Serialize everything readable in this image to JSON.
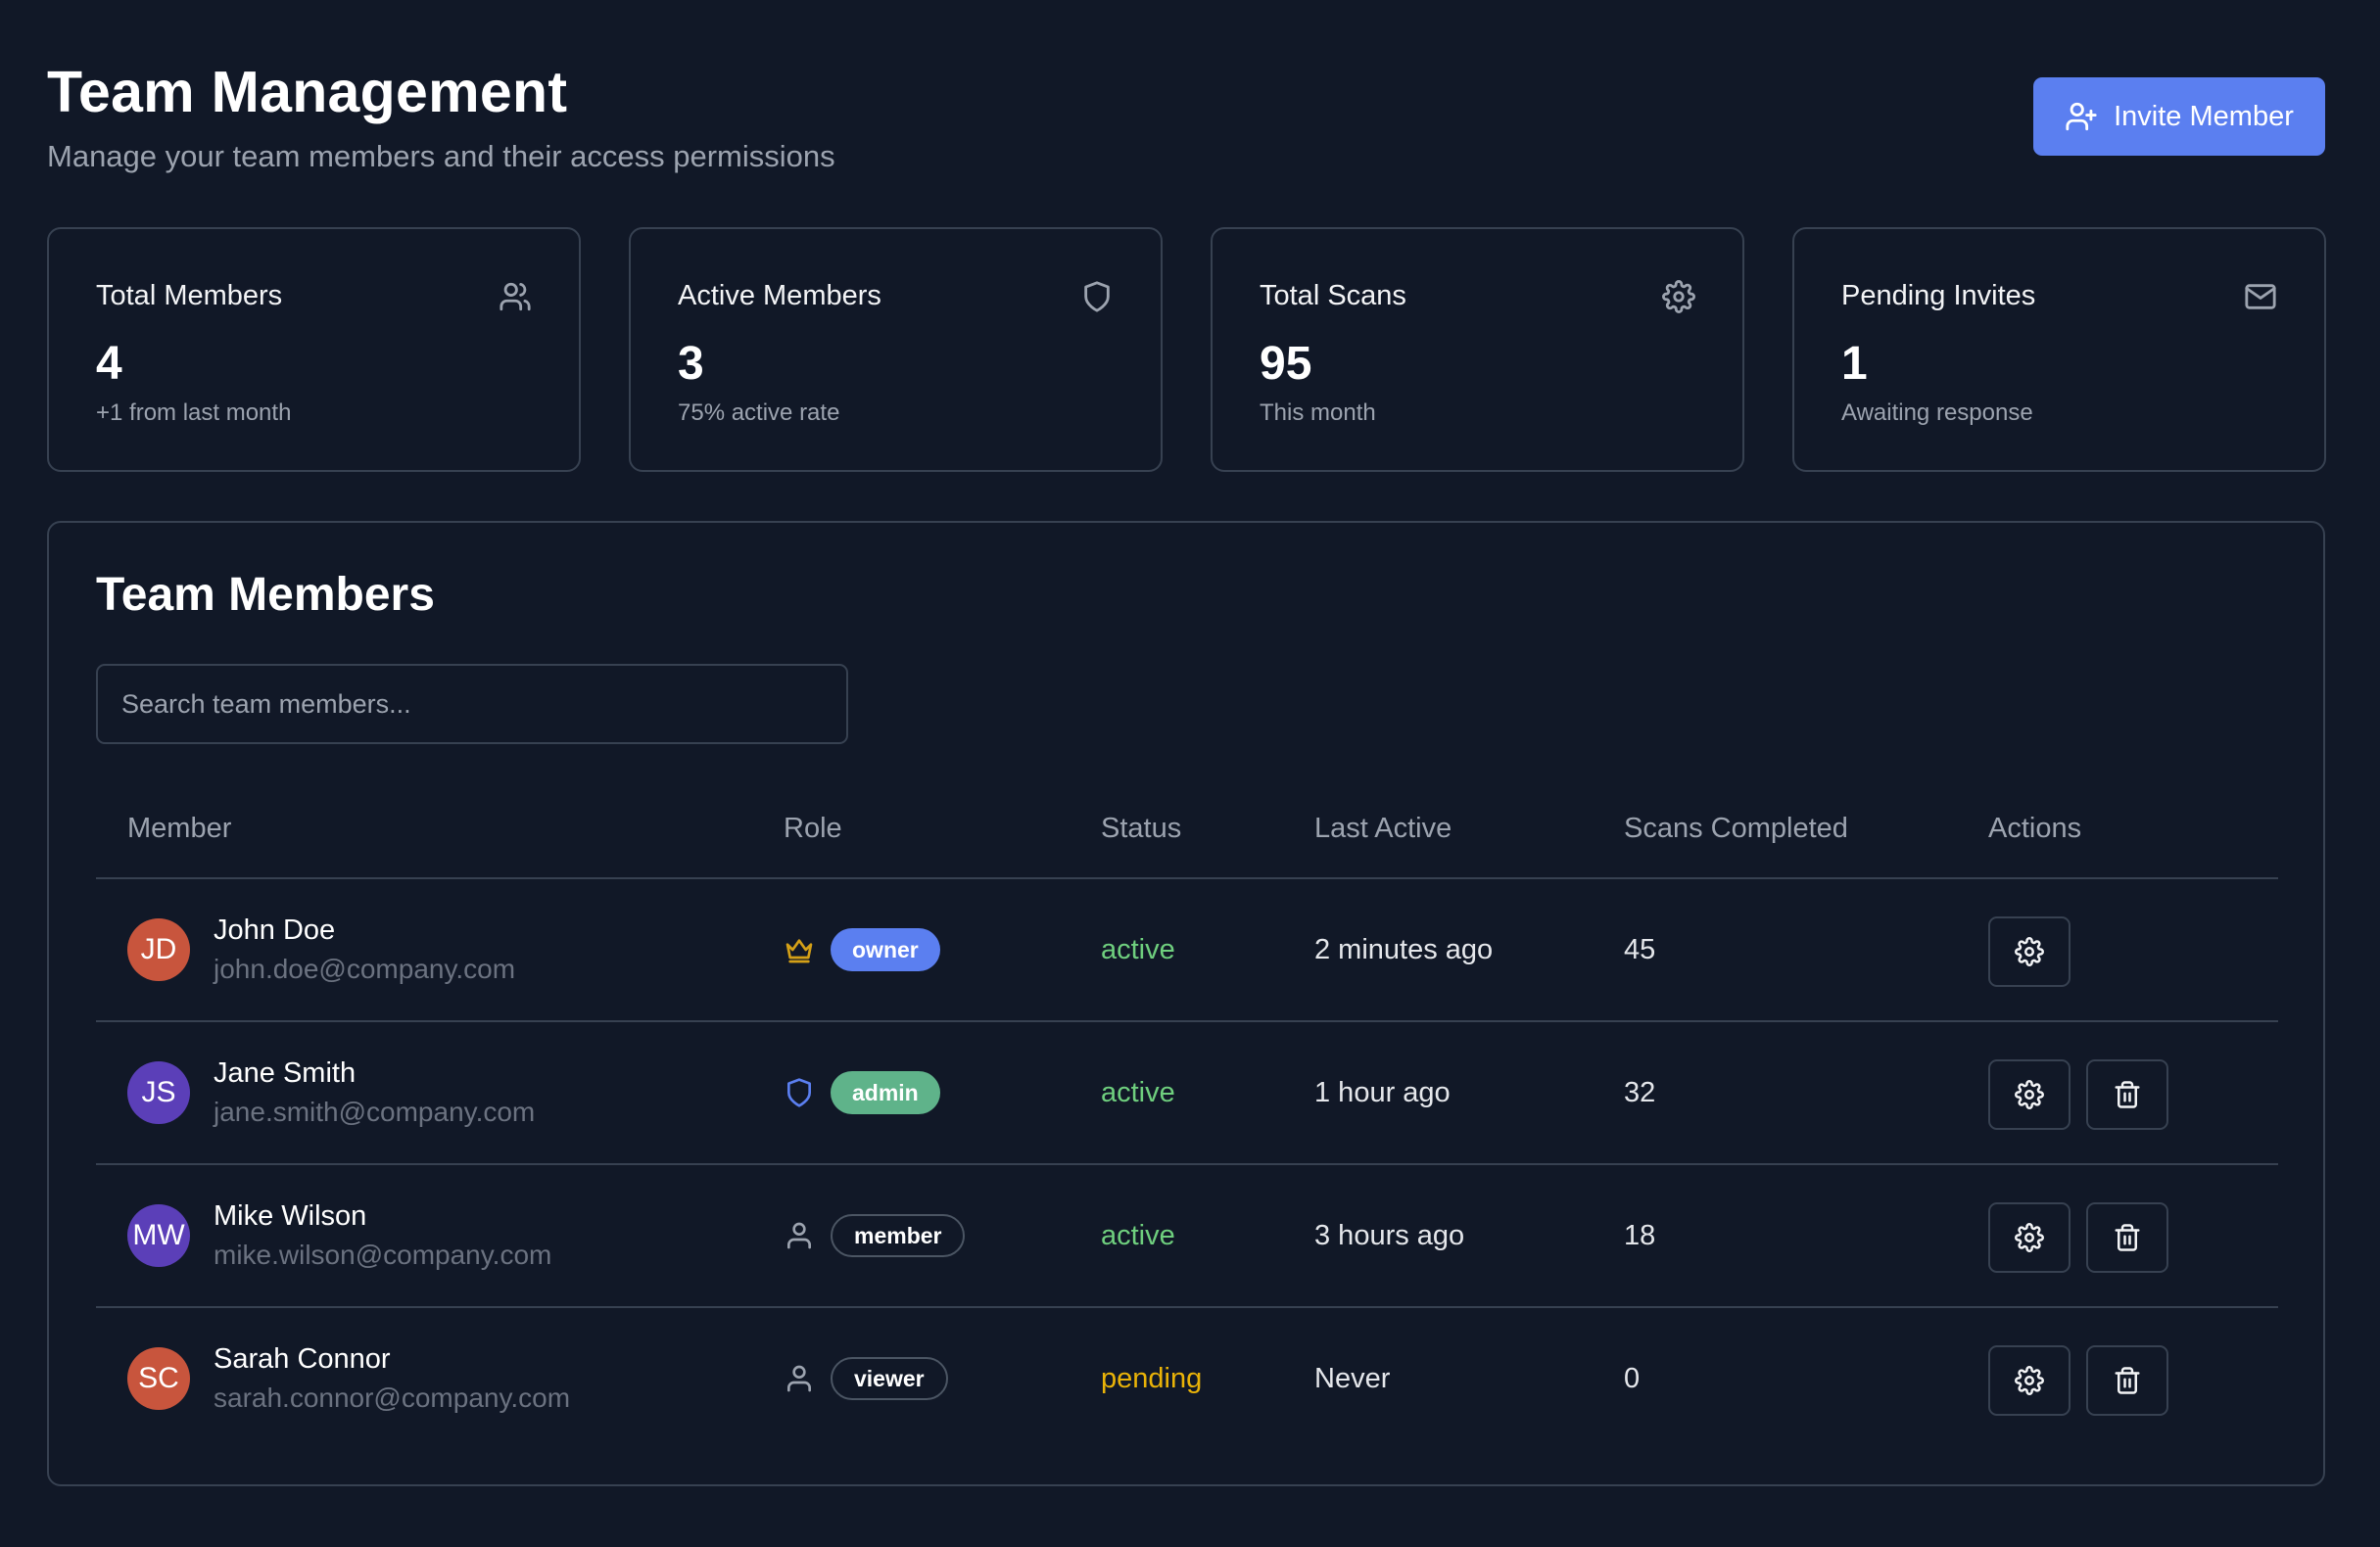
{
  "header": {
    "title": "Team Management",
    "subtitle": "Manage your team members and their access permissions",
    "invite_label": "Invite Member"
  },
  "stats": [
    {
      "title": "Total Members",
      "value": "4",
      "sub": "+1 from last month",
      "icon": "users-icon"
    },
    {
      "title": "Active Members",
      "value": "3",
      "sub": "75% active rate",
      "icon": "shield-icon"
    },
    {
      "title": "Total Scans",
      "value": "95",
      "sub": "This month",
      "icon": "gear-icon"
    },
    {
      "title": "Pending Invites",
      "value": "1",
      "sub": "Awaiting response",
      "icon": "mail-icon"
    }
  ],
  "team": {
    "title": "Team Members",
    "search_placeholder": "Search team members...",
    "columns": [
      "Member",
      "Role",
      "Status",
      "Last Active",
      "Scans Completed",
      "Actions"
    ],
    "rows": [
      {
        "initials": "JD",
        "name": "John Doe",
        "email": "john.doe@company.com",
        "role": "owner",
        "role_icon": "crown-icon",
        "status": "active",
        "last_active": "2 minutes ago",
        "scans": "45",
        "avatar_color": "#c8553d",
        "can_delete": false
      },
      {
        "initials": "JS",
        "name": "Jane Smith",
        "email": "jane.smith@company.com",
        "role": "admin",
        "role_icon": "shield-icon",
        "status": "active",
        "last_active": "1 hour ago",
        "scans": "32",
        "avatar_color": "#5b3fb8",
        "can_delete": true
      },
      {
        "initials": "MW",
        "name": "Mike Wilson",
        "email": "mike.wilson@company.com",
        "role": "member",
        "role_icon": "user-icon",
        "status": "active",
        "last_active": "3 hours ago",
        "scans": "18",
        "avatar_color": "#5b3fb8",
        "can_delete": true
      },
      {
        "initials": "SC",
        "name": "Sarah Connor",
        "email": "sarah.connor@company.com",
        "role": "viewer",
        "role_icon": "user-icon",
        "status": "pending",
        "last_active": "Never",
        "scans": "0",
        "avatar_color": "#c8553d",
        "can_delete": true
      }
    ]
  },
  "colors": {
    "background": "#111827",
    "accent": "#5b7ff0",
    "owner_badge": "#5b7ff0",
    "admin_badge": "#5fb38a",
    "crown": "#d4a017",
    "admin_shield": "#5b7ff0",
    "status_active": "#6fcf7e",
    "status_pending": "#eab308"
  }
}
